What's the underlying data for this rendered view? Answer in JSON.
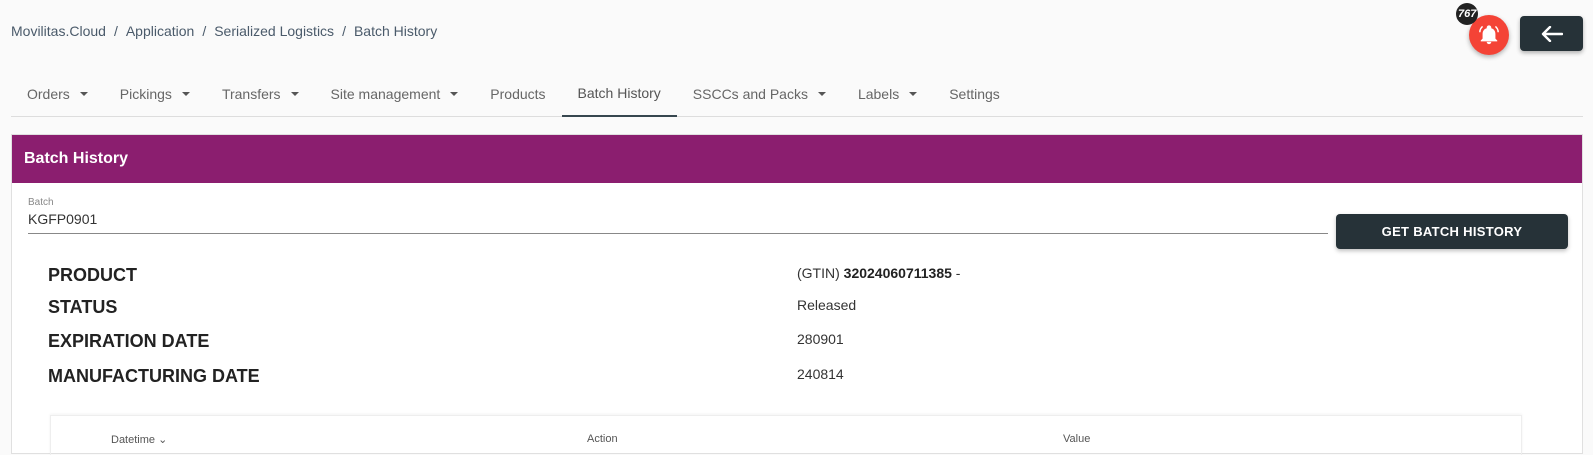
{
  "breadcrumb": [
    "Movilitas.Cloud",
    "Application",
    "Serialized Logistics",
    "Batch History"
  ],
  "notifications": {
    "count": "767",
    "icon": "bell-icon",
    "color": "#f44336"
  },
  "back_button": {
    "icon": "arrow-left-icon"
  },
  "tabs": [
    {
      "label": "Orders",
      "dropdown": true
    },
    {
      "label": "Pickings",
      "dropdown": true
    },
    {
      "label": "Transfers",
      "dropdown": true
    },
    {
      "label": "Site management",
      "dropdown": true
    },
    {
      "label": "Products",
      "dropdown": false
    },
    {
      "label": "Batch History",
      "dropdown": false,
      "active": true
    },
    {
      "label": "SSCCs and Packs",
      "dropdown": true
    },
    {
      "label": "Labels",
      "dropdown": true
    },
    {
      "label": "Settings",
      "dropdown": false
    }
  ],
  "card": {
    "title": "Batch History",
    "header_color": "#8b1e6f",
    "batch_label": "Batch",
    "batch_value": "KGFP0901",
    "get_button": "GET BATCH HISTORY"
  },
  "info": {
    "product_label": "PRODUCT",
    "product_prefix": "(GTIN)",
    "product_gtin": "32024060711385",
    "product_suffix": "-",
    "status_label": "STATUS",
    "status_value": "Released",
    "expiration_label": "EXPIRATION DATE",
    "expiration_value": "280901",
    "manufacturing_label": "MANUFACTURING DATE",
    "manufacturing_value": "240814"
  },
  "table": {
    "columns": [
      "Datetime ⌄",
      "Action",
      "Value"
    ]
  }
}
